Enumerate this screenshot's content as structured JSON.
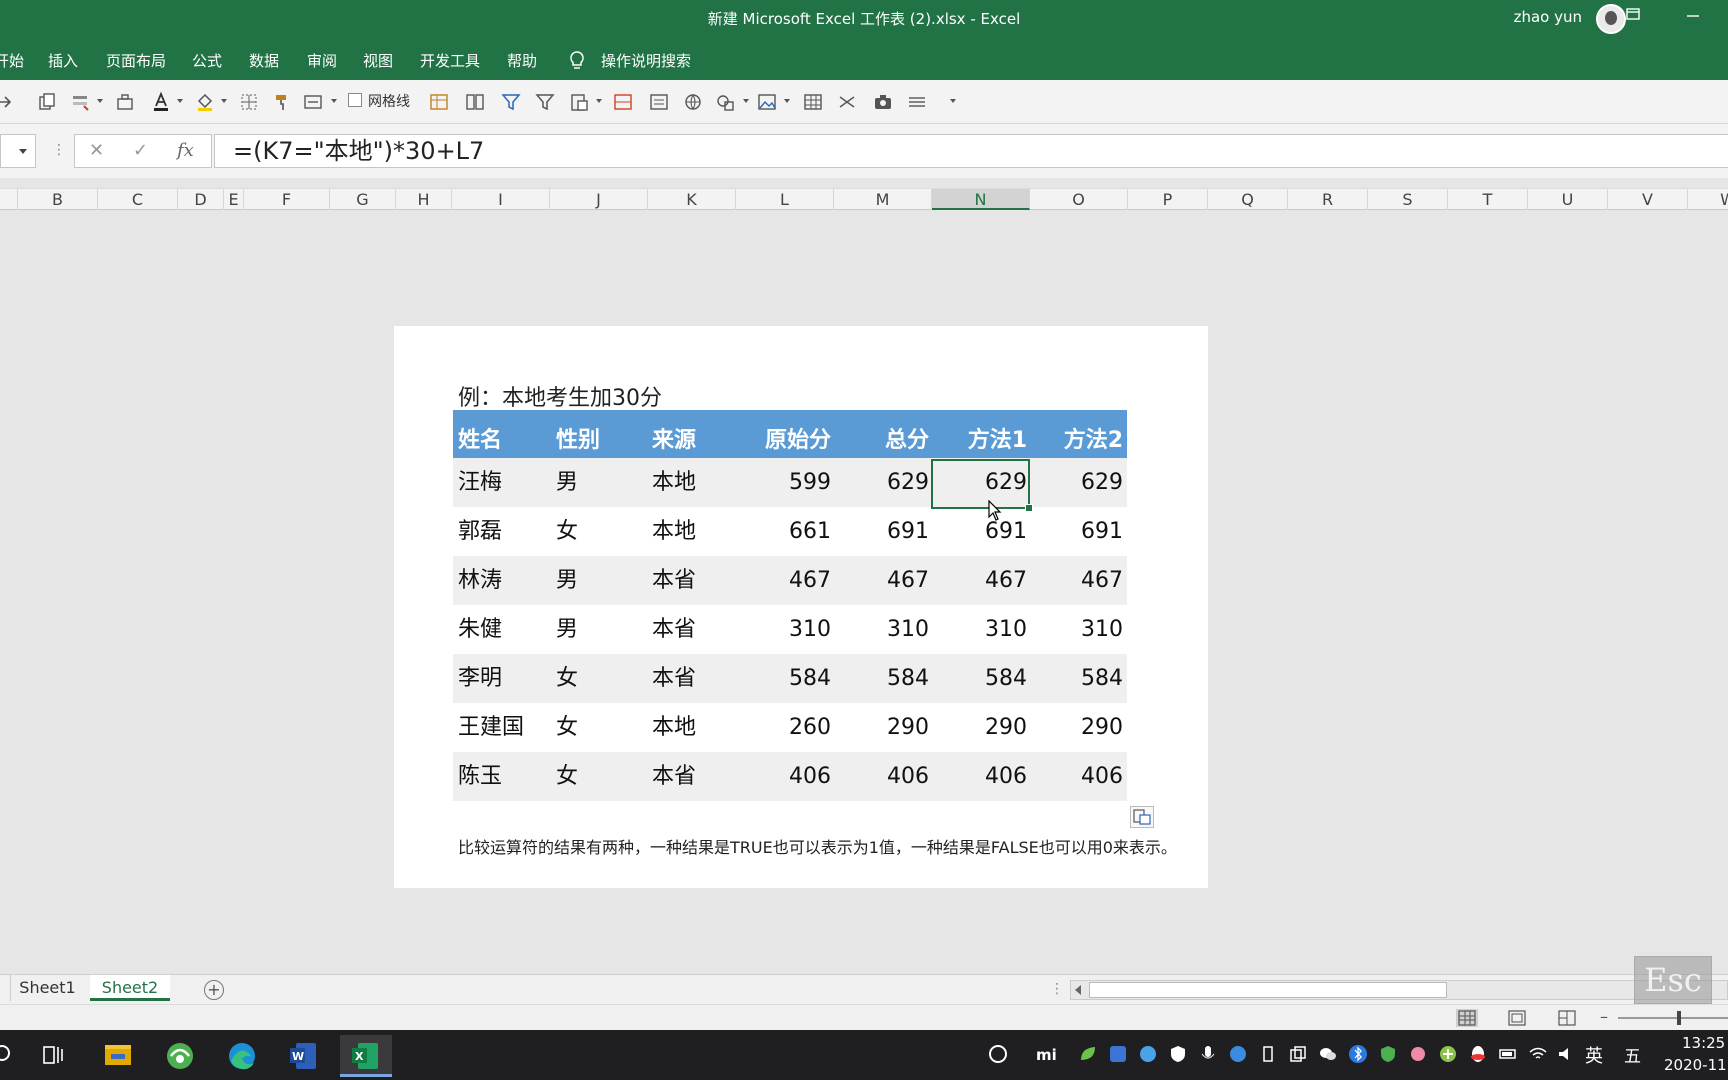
{
  "titlebar": {
    "title": "新建 Microsoft Excel 工作表 (2).xlsx  -  Excel",
    "user": "zhao yun",
    "restore_icon": "restore-icon",
    "minimize_icon": "minimize-icon"
  },
  "ribbon_tabs": [
    "开始",
    "插入",
    "页面布局",
    "公式",
    "数据",
    "审阅",
    "视图",
    "开发工具",
    "帮助"
  ],
  "tell_me": "操作说明搜索",
  "toolbar": {
    "gridlines_label": "网格线"
  },
  "formula_bar": {
    "cancel_symbol": "✕",
    "enter_symbol": "✓",
    "fx_symbol": "fx",
    "formula": "=(K7=\"本地\")*30+L7"
  },
  "columns": [
    "B",
    "C",
    "D",
    "E",
    "F",
    "G",
    "H",
    "I",
    "J",
    "K",
    "L",
    "M",
    "N",
    "O",
    "P",
    "Q",
    "R",
    "S",
    "T",
    "U",
    "V",
    "W"
  ],
  "selected_column": "N",
  "picture": {
    "title": "例：本地考生加30分",
    "headers": [
      "姓名",
      "性别",
      "来源",
      "原始分",
      "总分",
      "方法1",
      "方法2"
    ],
    "rows": [
      [
        "汪梅",
        "男",
        "本地",
        "599",
        "629",
        "629",
        "629"
      ],
      [
        "郭磊",
        "女",
        "本地",
        "661",
        "691",
        "691",
        "691"
      ],
      [
        "林涛",
        "男",
        "本省",
        "467",
        "467",
        "467",
        "467"
      ],
      [
        "朱健",
        "男",
        "本省",
        "310",
        "310",
        "310",
        "310"
      ],
      [
        "李明",
        "女",
        "本省",
        "584",
        "584",
        "584",
        "584"
      ],
      [
        "王建国",
        "女",
        "本地",
        "260",
        "290",
        "290",
        "290"
      ],
      [
        "陈玉",
        "女",
        "本省",
        "406",
        "406",
        "406",
        "406"
      ]
    ],
    "note": "比较运算符的结果有两种，一种结果是TRUE也可以表示为1值，一种结果是FALSE也可以用0来表示。"
  },
  "sheets": [
    "Sheet1",
    "Sheet2"
  ],
  "active_sheet": "Sheet2",
  "esc_badge": "Esc",
  "taskbar": {
    "ime_lang": "英",
    "ime_mode": "五",
    "time": "13:25",
    "date": "2020-11"
  },
  "colors": {
    "excel_green": "#217346",
    "table_header": "#5b9bd5",
    "row_alt": "#efefef"
  }
}
